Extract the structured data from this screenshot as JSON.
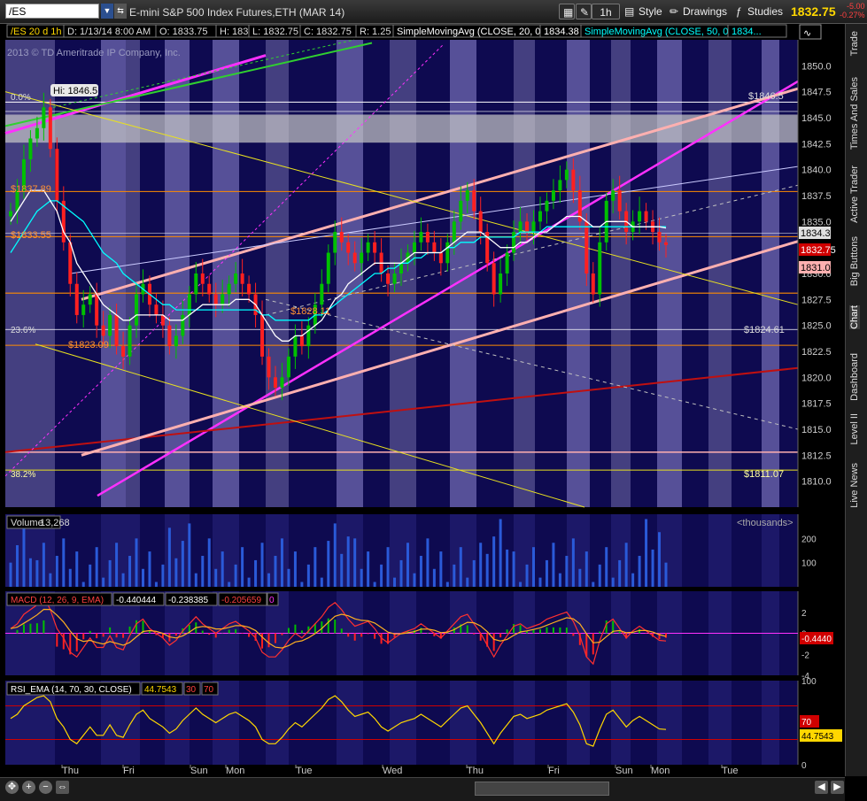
{
  "toolbar": {
    "symbol": "/ES",
    "instrument_title": "E-mini S&P 500 Index Futures,ETH (MAR 14)",
    "aggregation": "1h",
    "style_label": "Style",
    "drawings_label": "Drawings",
    "studies_label": "Studies",
    "last_price": "1832.75",
    "change": "-5.00",
    "change_pct": "-0.27%"
  },
  "sidebar": {
    "tabs": [
      "Trade",
      "Times And Sales",
      "Active Trader",
      "Big Buttons",
      "Chart",
      "Dashboard",
      "Level II",
      "Live News"
    ],
    "active": "Chart"
  },
  "price_panel": {
    "header": {
      "period": "/ES 20 d 1h",
      "date": "D: 1/13/14 8:00 AM",
      "open": "O: 1833.75",
      "high": "H: 1834",
      "low": "L: 1832.75",
      "close": "C: 1832.75",
      "ratio": "R: 1.25",
      "sma20_label": "SimpleMovingAvg (CLOSE, 20, 0)",
      "sma20_value": "1834.38",
      "sma50_label": "SimpleMovingAvg (CLOSE, 50, 0)",
      "sma50_value": "1834..."
    },
    "copyright": "2013 © TD Ameritrade IP Company, Inc.",
    "hi_label": "Hi: 1846.5",
    "fib_labels": [
      "0.0%",
      "23.6%",
      "38.2%"
    ],
    "level_labels": {
      "left": [
        "$1837.89",
        "$1833.55",
        "$1823.09",
        "$1828.11"
      ],
      "right": [
        "$1846.5",
        "$1824.61",
        "$1811.07"
      ]
    },
    "price_badges": [
      "1834.38",
      "1832.75",
      "1831.01"
    ],
    "colors": {
      "sma20": "#ffffff",
      "sma50": "#00ffff",
      "up": "#00c000",
      "down": "#ff2020",
      "channel": "#ffb0b0",
      "magenta": "#ff30ff",
      "green_trend": "#30d030",
      "red_trend": "#c01010",
      "yellow": "#e8e020",
      "orange_level": "#ff8c00"
    }
  },
  "volume_panel": {
    "label": "Volume",
    "value": "13,268",
    "unit": "<thousands>"
  },
  "macd_panel": {
    "label": "MACD (12, 26, 9, EMA)",
    "v1": "-0.440444",
    "v2": "-0.238385",
    "v3": "-0.205659",
    "v4": "0",
    "badge": "-0.4440"
  },
  "rsi_panel": {
    "label": "RSI_EMA (14, 70, 30, CLOSE)",
    "value": "44.7543",
    "ob": "70",
    "os": "30",
    "badge_ob": "70",
    "badge_val": "44.7543"
  },
  "time_axis": [
    "Thu",
    "Fri",
    "Sun",
    "Mon",
    "Tue",
    "Wed",
    "Thu",
    "Fri",
    "Sun",
    "Mon",
    "Tue"
  ],
  "chart_data": [
    {
      "type": "candlestick",
      "title": "/ES 20 d 1h",
      "ylim": [
        1807.5,
        1852.5
      ],
      "yticks": [
        1810,
        1812.5,
        1815,
        1817.5,
        1820,
        1822.5,
        1825,
        1827.5,
        1830,
        1832.5,
        1835,
        1837.5,
        1840,
        1842.5,
        1845,
        1847.5,
        1850
      ],
      "close_path": [
        1836,
        1838,
        1841,
        1843,
        1844,
        1846,
        1842,
        1837,
        1833,
        1829,
        1826,
        1827,
        1828,
        1825,
        1824,
        1826,
        1823,
        1822,
        1825,
        1828,
        1829,
        1827,
        1826,
        1825,
        1823,
        1824,
        1826,
        1828,
        1830,
        1829,
        1828,
        1827,
        1828,
        1829,
        1830,
        1829,
        1828,
        1826,
        1822,
        1820,
        1819,
        1820,
        1822,
        1824,
        1823,
        1825,
        1827,
        1829,
        1832,
        1834,
        1833,
        1832,
        1831,
        1832,
        1833,
        1832,
        1830,
        1829,
        1830,
        1831,
        1832,
        1833,
        1834,
        1833,
        1832,
        1831,
        1833,
        1835,
        1837,
        1838,
        1836,
        1834,
        1831,
        1828,
        1830,
        1832,
        1834,
        1835,
        1834,
        1835,
        1836,
        1837,
        1838,
        1839,
        1840,
        1838,
        1835,
        1830,
        1828,
        1833,
        1837,
        1838,
        1836,
        1834,
        1835,
        1836,
        1835,
        1834,
        1833,
        1832.75
      ],
      "sma20": [
        1835,
        1836,
        1837,
        1838,
        1838,
        1838,
        1837,
        1836,
        1834,
        1833,
        1831,
        1830,
        1829,
        1828,
        1827,
        1826.5,
        1826,
        1825.5,
        1825.5,
        1826,
        1826,
        1826,
        1826,
        1826,
        1825.5,
        1825.5,
        1825.5,
        1826,
        1826.5,
        1827,
        1827,
        1827,
        1827,
        1827,
        1827.5,
        1827.5,
        1827.5,
        1827,
        1826,
        1825,
        1824,
        1823.5,
        1823.5,
        1824,
        1824,
        1824.5,
        1825,
        1825.5,
        1826.5,
        1827.5,
        1828,
        1829,
        1829.5,
        1830,
        1830.5,
        1831,
        1831,
        1831,
        1831,
        1831,
        1831.5,
        1832,
        1832,
        1832,
        1832,
        1832,
        1832.5,
        1833,
        1833.5,
        1834,
        1834,
        1834,
        1833.5,
        1833,
        1832.5,
        1832.5,
        1832.5,
        1833,
        1833,
        1833.5,
        1834,
        1834,
        1834.5,
        1835,
        1835.5,
        1835.5,
        1835.5,
        1835,
        1834.5,
        1834.5,
        1835,
        1835,
        1835,
        1835,
        1834.5,
        1834.5,
        1834.5,
        1834.5,
        1834.5,
        1834.38
      ],
      "sma50": [
        1832,
        1833,
        1834,
        1835,
        1836,
        1836.5,
        1837,
        1837,
        1836.5,
        1836,
        1835.5,
        1835,
        1834,
        1833,
        1832,
        1831.5,
        1831,
        1830,
        1829.5,
        1829,
        1828.5,
        1828,
        1827.5,
        1827,
        1827,
        1826.5,
        1826.5,
        1826.5,
        1826.5,
        1826.5,
        1826.5,
        1826.5,
        1826.5,
        1826.5,
        1826.5,
        1826.5,
        1826.5,
        1826.5,
        1826,
        1826,
        1825.5,
        1825.5,
        1825.5,
        1825.5,
        1825.5,
        1825.5,
        1826,
        1826,
        1826.5,
        1827,
        1827.5,
        1828,
        1828.5,
        1829,
        1829.5,
        1830,
        1830,
        1830.5,
        1830.5,
        1831,
        1831,
        1831.5,
        1831.5,
        1832,
        1832,
        1832,
        1832.5,
        1832.5,
        1833,
        1833,
        1833,
        1833.5,
        1833.5,
        1833.5,
        1833.5,
        1833.5,
        1833.5,
        1834,
        1834,
        1834,
        1834,
        1834.5,
        1834.5,
        1834.5,
        1834.5,
        1834.5,
        1834.5,
        1834.5,
        1834.5,
        1834.5,
        1834.5,
        1834.5,
        1834.5,
        1834.5,
        1834.5,
        1834.5,
        1834.5,
        1834.5,
        1834.5,
        1834.5
      ]
    },
    {
      "type": "bar",
      "title": "Volume",
      "ylim": [
        0,
        300
      ],
      "yticks": [
        100,
        200
      ]
    },
    {
      "type": "line",
      "title": "MACD (12, 26, 9, EMA)",
      "ylim": [
        -4,
        4
      ],
      "yticks": [
        -4,
        -2,
        0,
        2
      ]
    },
    {
      "type": "line",
      "title": "RSI_EMA (14, 70, 30, CLOSE)",
      "ylim": [
        0,
        100
      ],
      "yticks": [
        100,
        50,
        0
      ]
    }
  ]
}
